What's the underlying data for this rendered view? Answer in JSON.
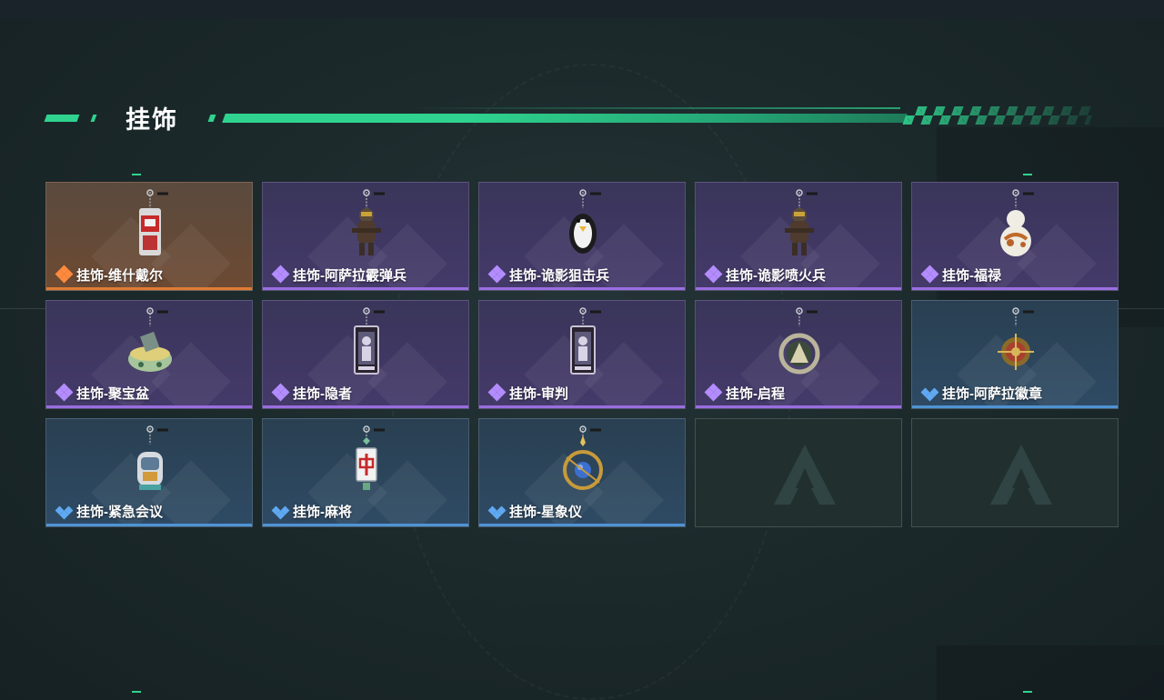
{
  "section": {
    "title": "挂饰"
  },
  "colors": {
    "accent": "#2fd38f",
    "rarity_orange": "#e07b33",
    "rarity_purple": "#9a6ee0",
    "rarity_blue": "#4f93d4"
  },
  "items": [
    {
      "label": "挂饰-维什戴尔",
      "rarity": "orange",
      "icon": "keychain-charm-icon"
    },
    {
      "label": "挂饰-阿萨拉霰弹兵",
      "rarity": "purple",
      "icon": "soldier-charm-icon"
    },
    {
      "label": "挂饰-诡影狙击兵",
      "rarity": "purple",
      "icon": "penguin-charm-icon"
    },
    {
      "label": "挂饰-诡影喷火兵",
      "rarity": "purple",
      "icon": "soldier-charm-icon"
    },
    {
      "label": "挂饰-福禄",
      "rarity": "purple",
      "icon": "gourd-charm-icon"
    },
    {
      "label": "挂饰-聚宝盆",
      "rarity": "purple",
      "icon": "treasure-bowl-charm-icon"
    },
    {
      "label": "挂饰-隐者",
      "rarity": "purple",
      "icon": "tarot-card-charm-icon"
    },
    {
      "label": "挂饰-审判",
      "rarity": "purple",
      "icon": "tarot-card-charm-icon"
    },
    {
      "label": "挂饰-启程",
      "rarity": "purple",
      "icon": "ring-emblem-charm-icon"
    },
    {
      "label": "挂饰-阿萨拉徽章",
      "rarity": "blue",
      "icon": "badge-charm-icon"
    },
    {
      "label": "挂饰-紧急会议",
      "rarity": "blue",
      "icon": "robot-charm-icon"
    },
    {
      "label": "挂饰-麻将",
      "rarity": "blue",
      "icon": "mahjong-tile-charm-icon"
    },
    {
      "label": "挂饰-星象仪",
      "rarity": "blue",
      "icon": "astrolabe-charm-icon"
    }
  ],
  "empty_slots": 2
}
